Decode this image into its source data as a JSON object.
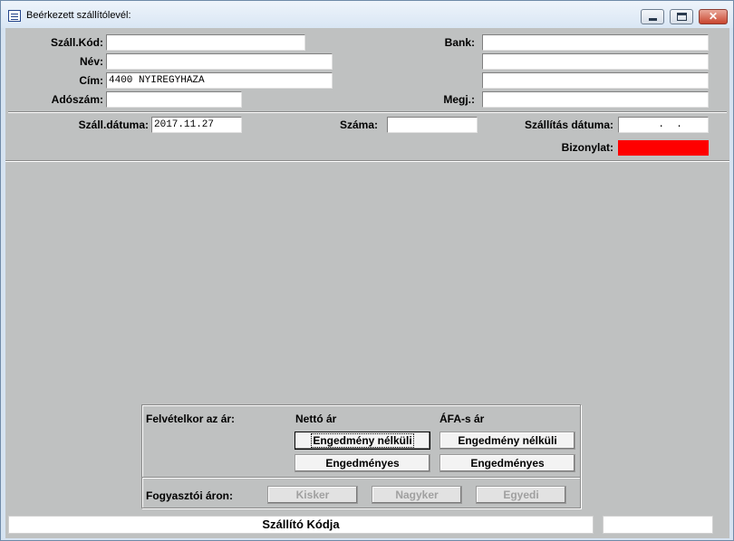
{
  "window": {
    "title": "Beérkezett szállítólevél:",
    "icon": "document-list-icon",
    "controls": [
      "minimize-icon",
      "maximize-icon",
      "close-icon"
    ],
    "close_glyph": "✕"
  },
  "supplier": {
    "code_label": "Száll.Kód:",
    "code_value": "",
    "name_label": "Név:",
    "name_value": "",
    "address_label": "Cím:",
    "address_value": "4400 NYIREGYHAZA",
    "tax_label": "Adószám:",
    "tax_value": "",
    "bank_label": "Bank:",
    "bank_value": "",
    "bank_line2": "",
    "bank_line3": "",
    "note_label": "Megj.:",
    "note_value": ""
  },
  "delivery": {
    "date_label": "Száll.dátuma:",
    "date_value": "2017.11.27",
    "number_label": "Száma:",
    "number_value": "",
    "ship_date_label": "Szállítás dátuma:",
    "ship_date_value": "  .  .",
    "document_label": "Bizonylat:",
    "document_color": "#ff0000"
  },
  "pricing": {
    "intake_label": "Felvételkor az ár:",
    "net_header": "Nettó ár",
    "vat_header": "ÁFA-s ár",
    "net_no_discount": "Engedmény nélküli",
    "net_discounted": "Engedményes",
    "vat_no_discount": "Engedmény nélküli",
    "vat_discounted": "Engedményes",
    "consumer_label": "Fogyasztói áron:",
    "retail": "Kisker",
    "wholesale": "Nagyker",
    "custom": "Egyedi"
  },
  "status": {
    "main": "Szállító Kódja",
    "secondary": ""
  }
}
